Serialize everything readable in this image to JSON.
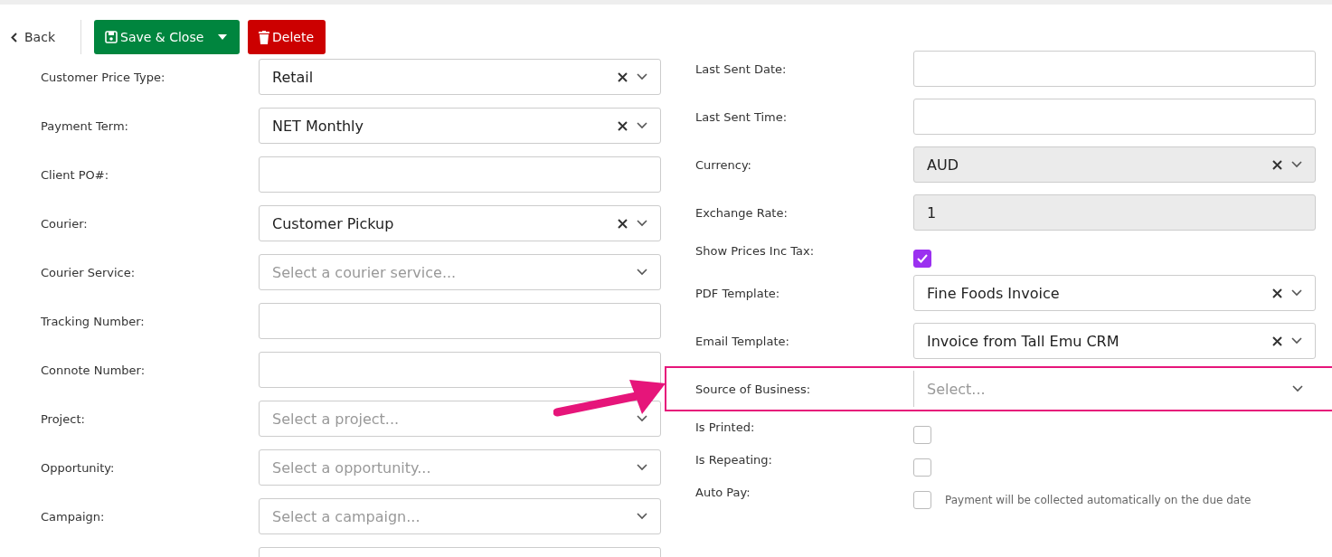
{
  "toolbar": {
    "back": "Back",
    "save_close": "Save & Close",
    "delete": "Delete"
  },
  "left_fields": [
    {
      "label": "Customer Price Type:",
      "kind": "select",
      "value": "Retail"
    },
    {
      "label": "Payment Term:",
      "kind": "select",
      "value": "NET Monthly"
    },
    {
      "label": "Client PO#:",
      "kind": "text"
    },
    {
      "label": "Courier:",
      "kind": "select",
      "value": "Customer Pickup"
    },
    {
      "label": "Courier Service:",
      "kind": "select",
      "placeholder": "Select a courier service..."
    },
    {
      "label": "Tracking Number:",
      "kind": "text"
    },
    {
      "label": "Connote Number:",
      "kind": "text"
    },
    {
      "label": "Project:",
      "kind": "select",
      "placeholder": "Select a project..."
    },
    {
      "label": "Opportunity:",
      "kind": "select",
      "placeholder": "Select a opportunity..."
    },
    {
      "label": "Campaign:",
      "kind": "select",
      "placeholder": "Select a campaign..."
    },
    {
      "kind": "text"
    }
  ],
  "right_fields": [
    {
      "label": "Last Sent Date:",
      "kind": "text"
    },
    {
      "label": "Last Sent Time:",
      "kind": "text"
    },
    {
      "label": "Currency:",
      "kind": "select",
      "value": "AUD",
      "disabled": true
    },
    {
      "label": "Exchange Rate:",
      "kind": "text",
      "value": "1",
      "disabled": true
    },
    {
      "label": "Show Prices Inc Tax:",
      "kind": "checkbox",
      "checked": true
    },
    {
      "label": "PDF Template:",
      "kind": "select",
      "value": "Fine Foods Invoice"
    },
    {
      "label": "Email Template:",
      "kind": "select",
      "value": "Invoice from Tall Emu CRM"
    },
    {
      "label": "Source of Business:",
      "kind": "select",
      "placeholder": "Select...",
      "highlighted": true
    },
    {
      "label": "Is Printed:",
      "kind": "checkbox",
      "checked": false
    },
    {
      "label": "Is Repeating:",
      "kind": "checkbox",
      "checked": false
    },
    {
      "label": "Auto Pay:",
      "kind": "checkbox",
      "checked": false,
      "note": "Payment will be collected automatically on the due date"
    }
  ]
}
